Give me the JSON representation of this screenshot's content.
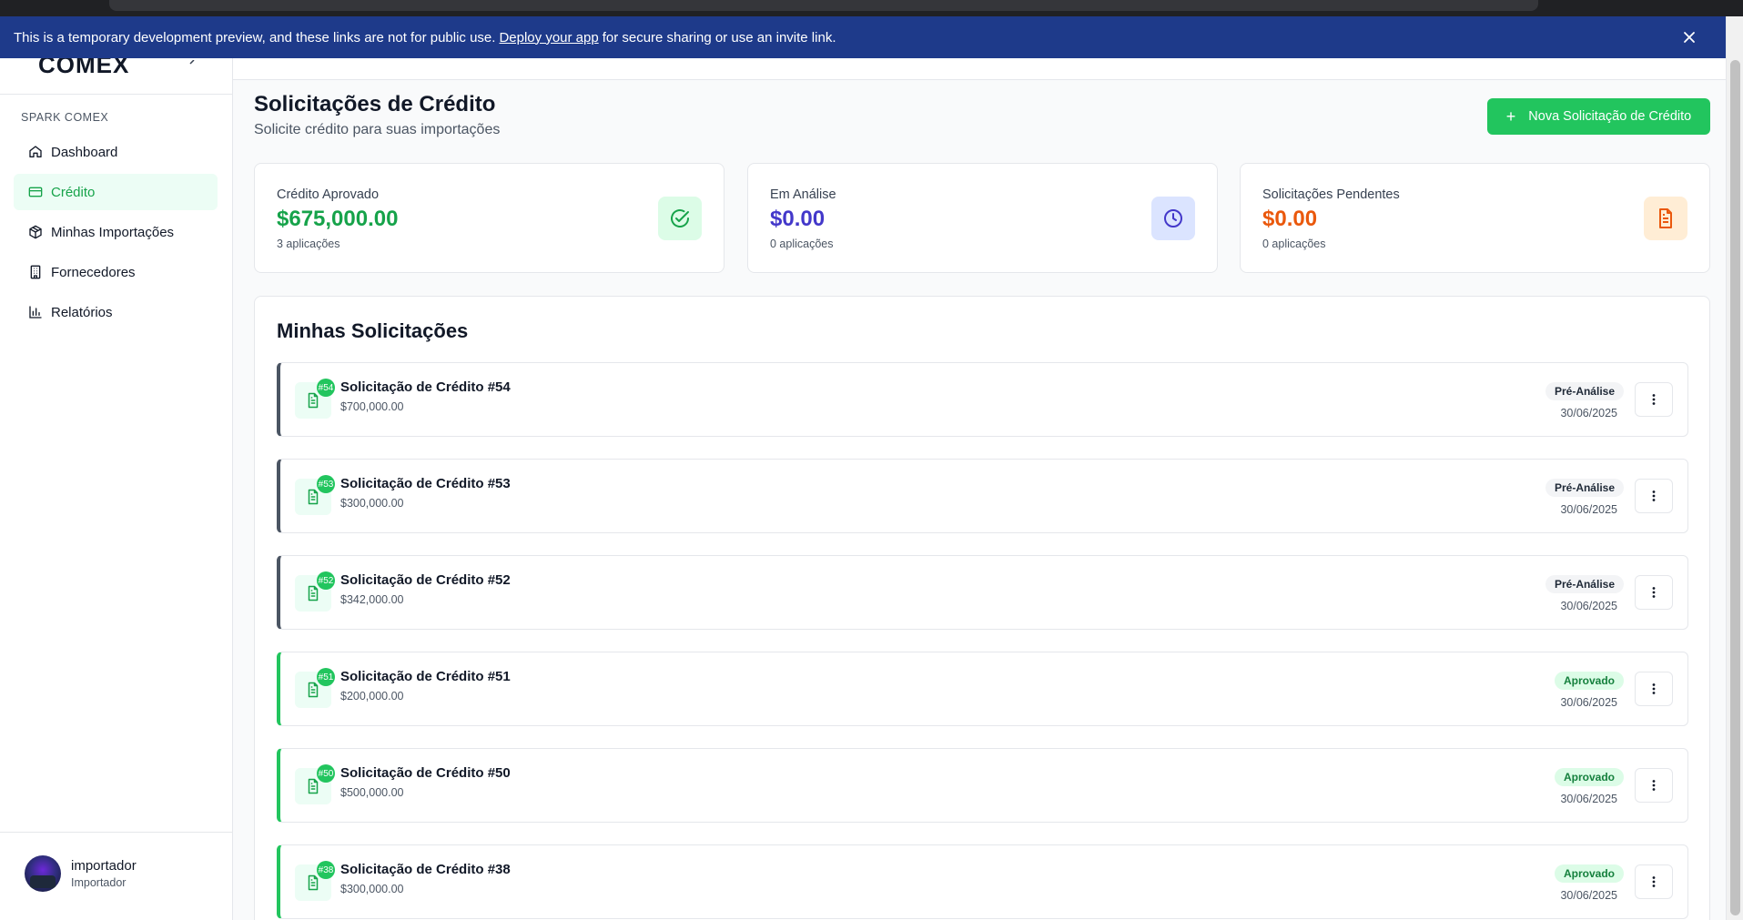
{
  "banner": {
    "text_before": "This is a temporary development preview, and these links are not for public use.",
    "link": "Deploy your app",
    "text_after": "for secure sharing or use an invite link."
  },
  "sidebar": {
    "logo": "COMEX",
    "section": "SPARK COMEX",
    "items": [
      {
        "label": "Dashboard",
        "icon": "home-icon",
        "active": false
      },
      {
        "label": "Crédito",
        "icon": "credit-card-icon",
        "active": true
      },
      {
        "label": "Minhas Importações",
        "icon": "package-icon",
        "active": false
      },
      {
        "label": "Fornecedores",
        "icon": "building-icon",
        "active": false
      },
      {
        "label": "Relatórios",
        "icon": "bar-chart-icon",
        "active": false
      }
    ],
    "user": {
      "name": "importador",
      "role": "Importador"
    }
  },
  "header": {
    "title": "Solicitações de Crédito",
    "subtitle": "Solicite crédito para suas importações",
    "new_button": "Nova Solicitação de Crédito"
  },
  "stats": [
    {
      "label": "Crédito Aprovado",
      "value": "$675,000.00",
      "sub": "3 aplicações",
      "color": "#16a34a",
      "icon": "check-circle-icon"
    },
    {
      "label": "Em Análise",
      "value": "$0.00",
      "sub": "0 aplicações",
      "color": "#4338ca",
      "icon": "clock-icon"
    },
    {
      "label": "Solicitações Pendentes",
      "value": "$0.00",
      "sub": "0 aplicações",
      "color": "#ea580c",
      "icon": "file-icon"
    }
  ],
  "requests": {
    "title": "Minhas Solicitações",
    "items": [
      {
        "num": "#54",
        "title": "Solicitação de Crédito #54",
        "amount": "$700,000.00",
        "status": "Pré-Análise",
        "date": "30/06/2025"
      },
      {
        "num": "#53",
        "title": "Solicitação de Crédito #53",
        "amount": "$300,000.00",
        "status": "Pré-Análise",
        "date": "30/06/2025"
      },
      {
        "num": "#52",
        "title": "Solicitação de Crédito #52",
        "amount": "$342,000.00",
        "status": "Pré-Análise",
        "date": "30/06/2025"
      },
      {
        "num": "#51",
        "title": "Solicitação de Crédito #51",
        "amount": "$200,000.00",
        "status": "Aprovado",
        "date": "30/06/2025"
      },
      {
        "num": "#50",
        "title": "Solicitação de Crédito #50",
        "amount": "$500,000.00",
        "status": "Aprovado",
        "date": "30/06/2025"
      },
      {
        "num": "#38",
        "title": "Solicitação de Crédito #38",
        "amount": "$300,000.00",
        "status": "Aprovado",
        "date": "30/06/2025"
      }
    ]
  },
  "colors": {
    "accent": "#22c55e",
    "banner": "#1e3a8a"
  }
}
